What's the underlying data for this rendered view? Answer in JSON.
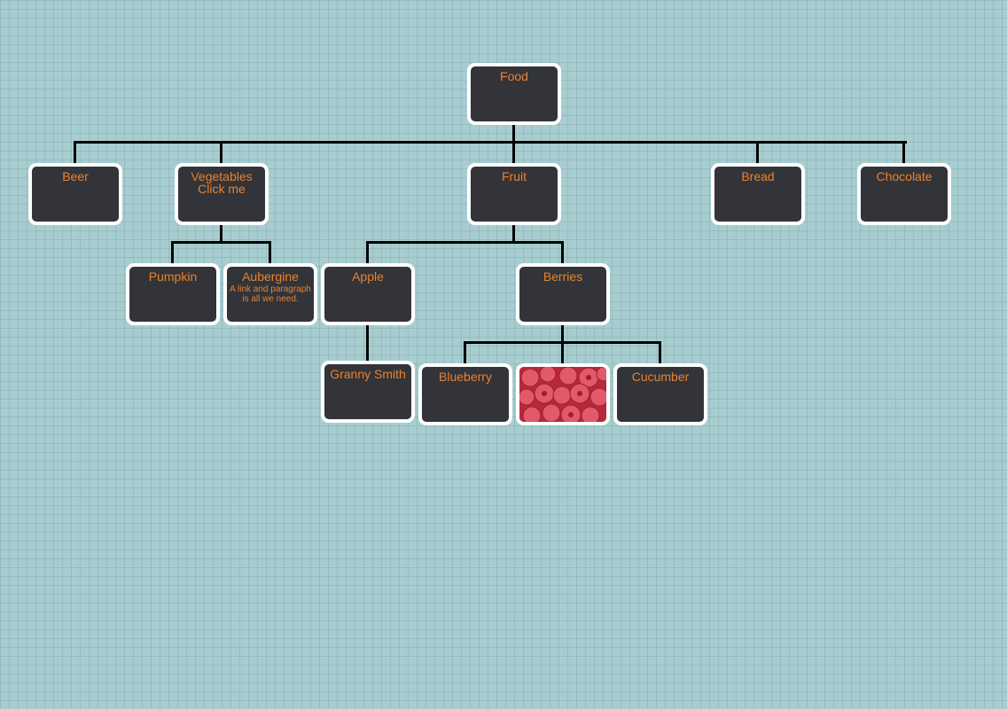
{
  "colors": {
    "background": "#a8cdd0",
    "node_fill": "#333439",
    "node_border": "#ffffff",
    "text": "#e8822f",
    "connector": "#000000"
  },
  "nodes": {
    "food": {
      "label": "Food"
    },
    "beer": {
      "label": "Beer"
    },
    "vegetables": {
      "label": "Vegetables",
      "link": "Click me"
    },
    "fruit": {
      "label": "Fruit"
    },
    "bread": {
      "label": "Bread"
    },
    "chocolate": {
      "label": "Chocolate"
    },
    "pumpkin": {
      "label": "Pumpkin"
    },
    "aubergine": {
      "label": "Aubergine",
      "paragraph": "A link and paragraph is all we need."
    },
    "apple": {
      "label": "Apple"
    },
    "berries": {
      "label": "Berries"
    },
    "granny_smith": {
      "label": "Granny Smith"
    },
    "blueberry": {
      "label": "Blueberry"
    },
    "raspberry": {
      "image": "raspberries-photo"
    },
    "cucumber": {
      "label": "Cucumber"
    }
  }
}
